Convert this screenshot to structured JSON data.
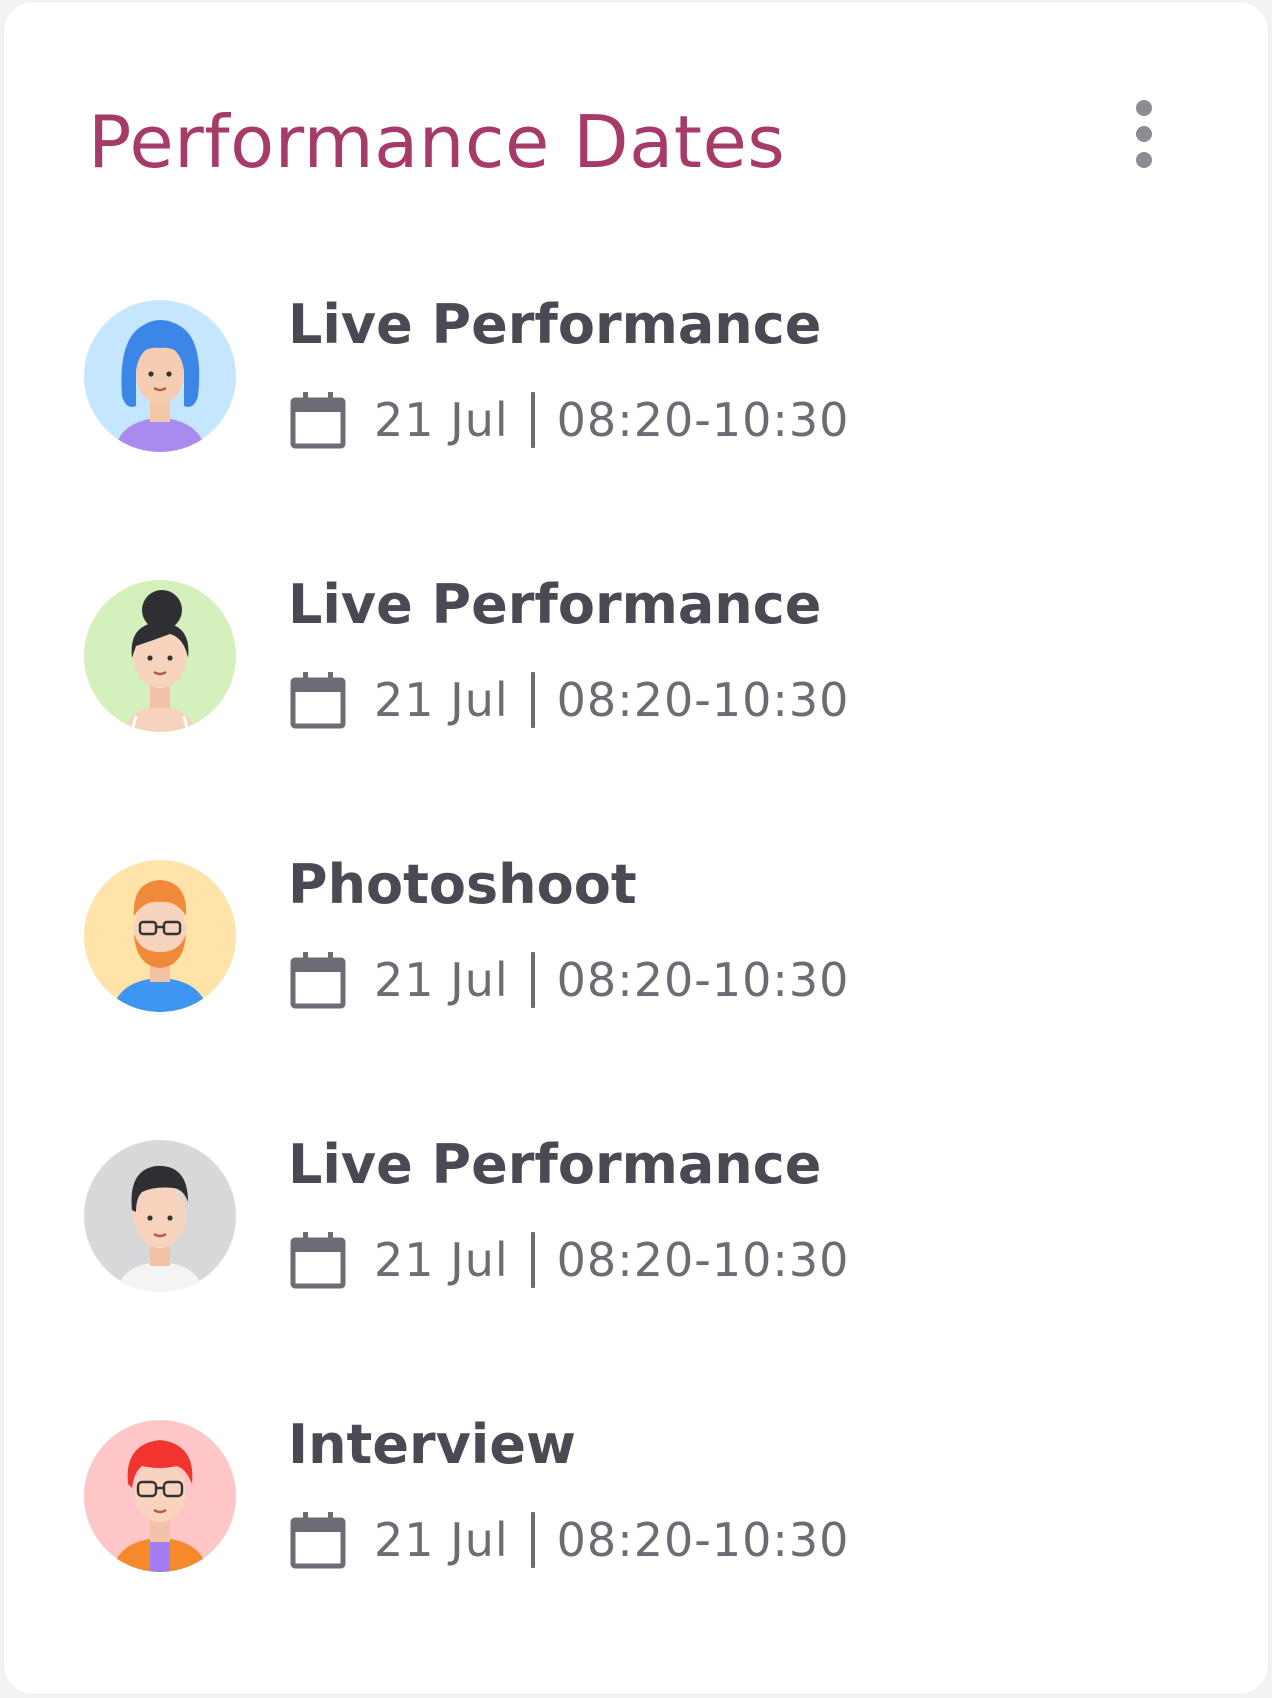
{
  "card": {
    "title": "Performance Dates",
    "menu_icon": "more-vertical-icon"
  },
  "events": [
    {
      "title": "Live Performance",
      "date": "21 Jul",
      "time": "08:20-10:30",
      "avatar": "avatar-blue-hair-woman",
      "avatar_bg": "#c5e6ff"
    },
    {
      "title": "Live Performance",
      "date": "21 Jul",
      "time": "08:20-10:30",
      "avatar": "avatar-bun-hair-woman",
      "avatar_bg": "#d3f0bd"
    },
    {
      "title": "Photoshoot",
      "date": "21 Jul",
      "time": "08:20-10:30",
      "avatar": "avatar-bearded-man-glasses",
      "avatar_bg": "#ffe3a8"
    },
    {
      "title": "Live Performance",
      "date": "21 Jul",
      "time": "08:20-10:30",
      "avatar": "avatar-dark-hair-man",
      "avatar_bg": "#d8d8da"
    },
    {
      "title": "Interview",
      "date": "21 Jul",
      "time": "08:20-10:30",
      "avatar": "avatar-red-hair-glasses",
      "avatar_bg": "#ffc6c8"
    }
  ],
  "icons": {
    "calendar": "calendar-icon"
  },
  "colors": {
    "title": "#a63b6a",
    "event_title": "#4a4a55",
    "meta_text": "#6d6c74",
    "menu_dots": "#8d8c92"
  }
}
